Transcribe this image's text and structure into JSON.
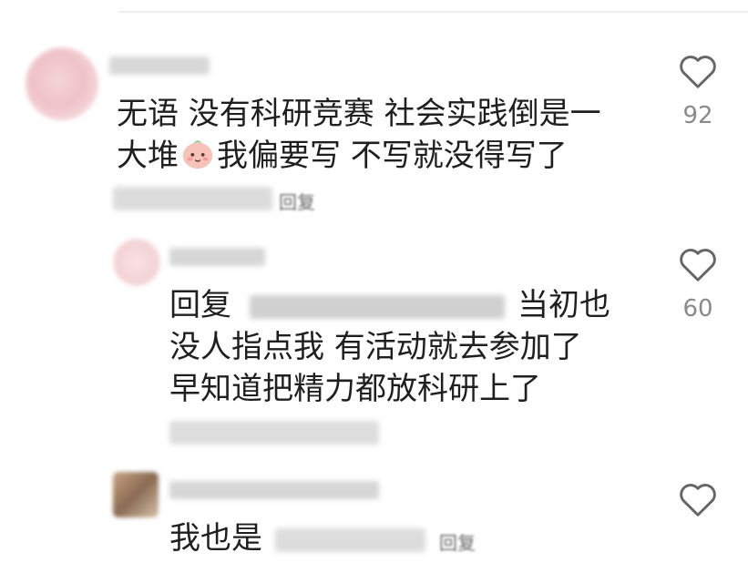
{
  "comments": [
    {
      "text_line1": "无语 没有科研竞赛 社会实践倒是一",
      "text_line2_before": "大堆",
      "text_line2_emoji": "peach-face-emoji",
      "text_line2_after": "我偏要写 不写就没得写了",
      "reply_label": "回复",
      "like_count": "92",
      "replies": [
        {
          "prefix": "回复",
          "text_line1_after": "当初也",
          "text_line2": "没人指点我 有活动就去参加了",
          "text_line3": "早知道把精力都放科研上了",
          "like_count": "60"
        }
      ]
    },
    {
      "text": "我也是",
      "reply_label": "回复"
    }
  ],
  "icons": {
    "like": "heart-outline-icon"
  },
  "colors": {
    "text": "#1f1f1f",
    "muted": "#8a8a8a",
    "icon": "#666666"
  }
}
